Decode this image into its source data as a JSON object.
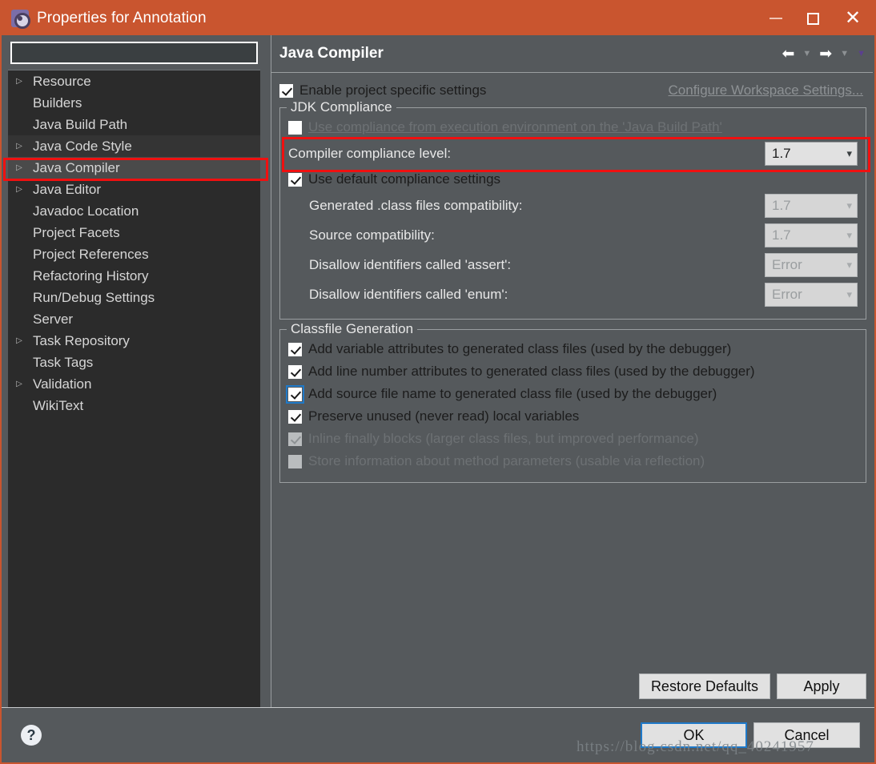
{
  "window": {
    "title": "Properties for Annotation",
    "icon": "gear-icon",
    "minimize_label": "Minimize",
    "maximize_label": "Maximize",
    "close_label": "Close",
    "accent_color": "#c9552f",
    "background_color": "#55595c",
    "annotation_color": "#f01010"
  },
  "sidebar": {
    "filter_value": "",
    "filter_placeholder": "",
    "items": [
      {
        "label": "Resource",
        "expandable": true,
        "selected": false
      },
      {
        "label": "Builders",
        "expandable": false,
        "selected": false
      },
      {
        "label": "Java Build Path",
        "expandable": false,
        "selected": false
      },
      {
        "label": "Java Code Style",
        "expandable": true,
        "selected": false
      },
      {
        "label": "Java Compiler",
        "expandable": true,
        "selected": true
      },
      {
        "label": "Java Editor",
        "expandable": true,
        "selected": false
      },
      {
        "label": "Javadoc Location",
        "expandable": false,
        "selected": false
      },
      {
        "label": "Project Facets",
        "expandable": false,
        "selected": false
      },
      {
        "label": "Project References",
        "expandable": false,
        "selected": false
      },
      {
        "label": "Refactoring History",
        "expandable": false,
        "selected": false
      },
      {
        "label": "Run/Debug Settings",
        "expandable": false,
        "selected": false
      },
      {
        "label": "Server",
        "expandable": false,
        "selected": false
      },
      {
        "label": "Task Repository",
        "expandable": true,
        "selected": false
      },
      {
        "label": "Task Tags",
        "expandable": false,
        "selected": false
      },
      {
        "label": "Validation",
        "expandable": true,
        "selected": false
      },
      {
        "label": "WikiText",
        "expandable": false,
        "selected": false
      }
    ]
  },
  "page": {
    "title": "Java Compiler",
    "nav": {
      "back_icon": "arrow-left-icon",
      "back_menu_icon": "caret-down-icon",
      "forward_icon": "arrow-right-icon",
      "forward_menu_icon": "caret-down-icon",
      "view_menu_icon": "caret-down-icon"
    },
    "enable_project_specific": {
      "label": "Enable project specific settings",
      "checked": true
    },
    "configure_workspace_link": "Configure Workspace Settings...",
    "jdk_compliance": {
      "legend": "JDK Compliance",
      "use_execution_env": {
        "label_prefix": "Use compliance from execution environment on the ",
        "label_link": "'Java Build Path'",
        "checked": false,
        "enabled": false
      },
      "compiler_compliance_level": {
        "label": "Compiler compliance level:",
        "value": "1.7",
        "enabled": true,
        "annotated": true
      },
      "use_default_compliance": {
        "label": "Use default compliance settings",
        "checked": true
      },
      "sub_settings": [
        {
          "label": "Generated .class files compatibility:",
          "value": "1.7",
          "enabled": false
        },
        {
          "label": "Source compatibility:",
          "value": "1.7",
          "enabled": false
        },
        {
          "label": "Disallow identifiers called 'assert':",
          "value": "Error",
          "enabled": false
        },
        {
          "label": "Disallow identifiers called 'enum':",
          "value": "Error",
          "enabled": false
        }
      ]
    },
    "classfile_generation": {
      "legend": "Classfile Generation",
      "options": [
        {
          "label": "Add variable attributes to generated class files (used by the debugger)",
          "checked": true,
          "enabled": true,
          "focused": false
        },
        {
          "label": "Add line number attributes to generated class files (used by the debugger)",
          "checked": true,
          "enabled": true,
          "focused": false
        },
        {
          "label": "Add source file name to generated class file (used by the debugger)",
          "checked": true,
          "enabled": true,
          "focused": true
        },
        {
          "label": "Preserve unused (never read) local variables",
          "checked": true,
          "enabled": true,
          "focused": false
        },
        {
          "label": "Inline finally blocks (larger class files, but improved performance)",
          "checked": true,
          "enabled": false,
          "focused": false
        },
        {
          "label": "Store information about method parameters (usable via reflection)",
          "checked": false,
          "enabled": false,
          "focused": false
        }
      ]
    },
    "restore_defaults_button": "Restore Defaults",
    "apply_button": "Apply"
  },
  "footer": {
    "help_icon": "question-mark-icon",
    "ok_button": "OK",
    "cancel_button": "Cancel"
  },
  "watermark": "https://blog.csdn.net/qq_40241957"
}
